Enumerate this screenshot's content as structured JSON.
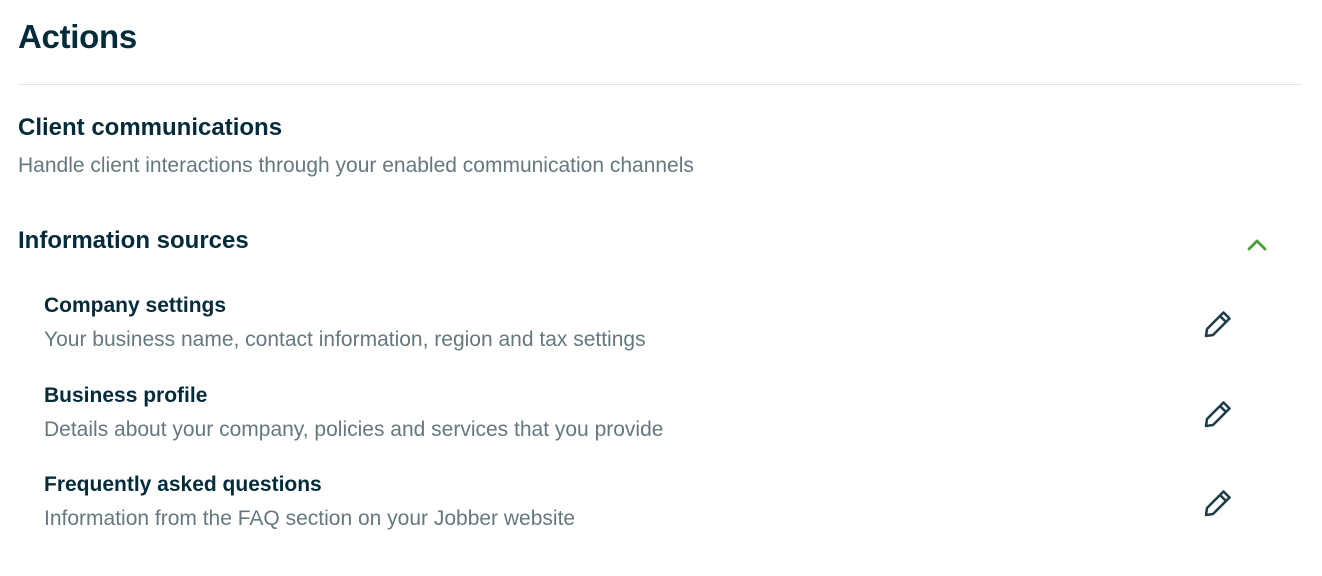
{
  "page": {
    "title": "Actions"
  },
  "client_communications": {
    "heading": "Client communications",
    "description": "Handle client interactions through your enabled communication channels"
  },
  "information_sources": {
    "heading": "Information sources",
    "toggle_icon": "chevron-up-icon",
    "expanded": true,
    "items": [
      {
        "title": "Company settings",
        "description": "Your business name, contact information, region and tax settings",
        "action_icon": "pencil-icon"
      },
      {
        "title": "Business profile",
        "description": "Details about your company, policies and services that you provide",
        "action_icon": "pencil-icon"
      },
      {
        "title": "Frequently asked questions",
        "description": "Information from the FAQ section on your Jobber website",
        "action_icon": "pencil-icon"
      }
    ]
  },
  "colors": {
    "heading": "#032b3a",
    "muted_text": "#65787f",
    "accent_green": "#4a9e3a",
    "icon": "#032b3a",
    "divider": "#e1e5e7"
  }
}
